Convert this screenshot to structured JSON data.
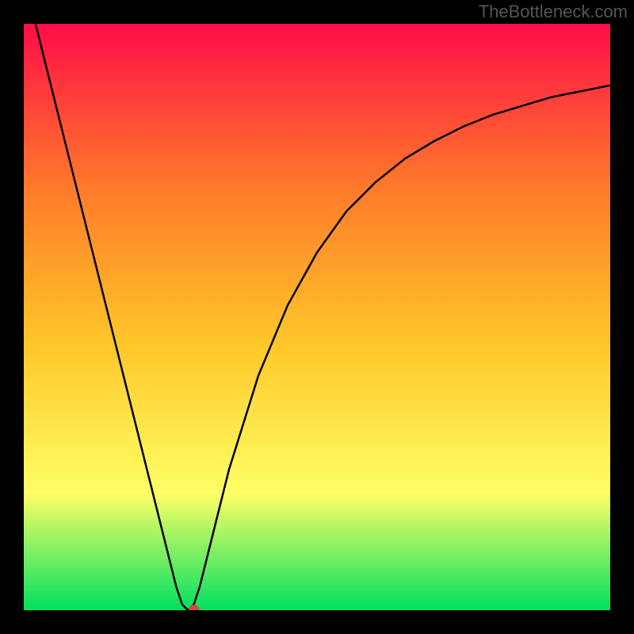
{
  "watermark": "TheBottleneck.com",
  "chart_data": {
    "type": "line",
    "title": "",
    "xlabel": "",
    "ylabel": "",
    "xlim": [
      0,
      100
    ],
    "ylim": [
      0,
      100
    ],
    "gradient_colors": {
      "top": "#FF0D48",
      "upper_mid": "#FF7A2A",
      "mid": "#FFC829",
      "lower_mid": "#FFFF66",
      "bottom": "#00E060"
    },
    "curve": {
      "description": "V-shaped bottleneck curve",
      "minimum_x": 28,
      "points": [
        {
          "x": 2,
          "y": 100
        },
        {
          "x": 5,
          "y": 88
        },
        {
          "x": 10,
          "y": 68
        },
        {
          "x": 15,
          "y": 48
        },
        {
          "x": 20,
          "y": 28
        },
        {
          "x": 24,
          "y": 12
        },
        {
          "x": 26,
          "y": 4
        },
        {
          "x": 27,
          "y": 1
        },
        {
          "x": 28,
          "y": 0
        },
        {
          "x": 29,
          "y": 1
        },
        {
          "x": 30,
          "y": 4
        },
        {
          "x": 32,
          "y": 12
        },
        {
          "x": 35,
          "y": 24
        },
        {
          "x": 40,
          "y": 40
        },
        {
          "x": 45,
          "y": 52
        },
        {
          "x": 50,
          "y": 61
        },
        {
          "x": 55,
          "y": 68
        },
        {
          "x": 60,
          "y": 73
        },
        {
          "x": 65,
          "y": 77
        },
        {
          "x": 70,
          "y": 80
        },
        {
          "x": 75,
          "y": 82.5
        },
        {
          "x": 80,
          "y": 84.5
        },
        {
          "x": 85,
          "y": 86
        },
        {
          "x": 90,
          "y": 87.5
        },
        {
          "x": 95,
          "y": 88.5
        },
        {
          "x": 100,
          "y": 89.5
        }
      ]
    },
    "marker": {
      "x": 29,
      "y": 0,
      "color": "#D04A3A",
      "radius": 7
    }
  }
}
